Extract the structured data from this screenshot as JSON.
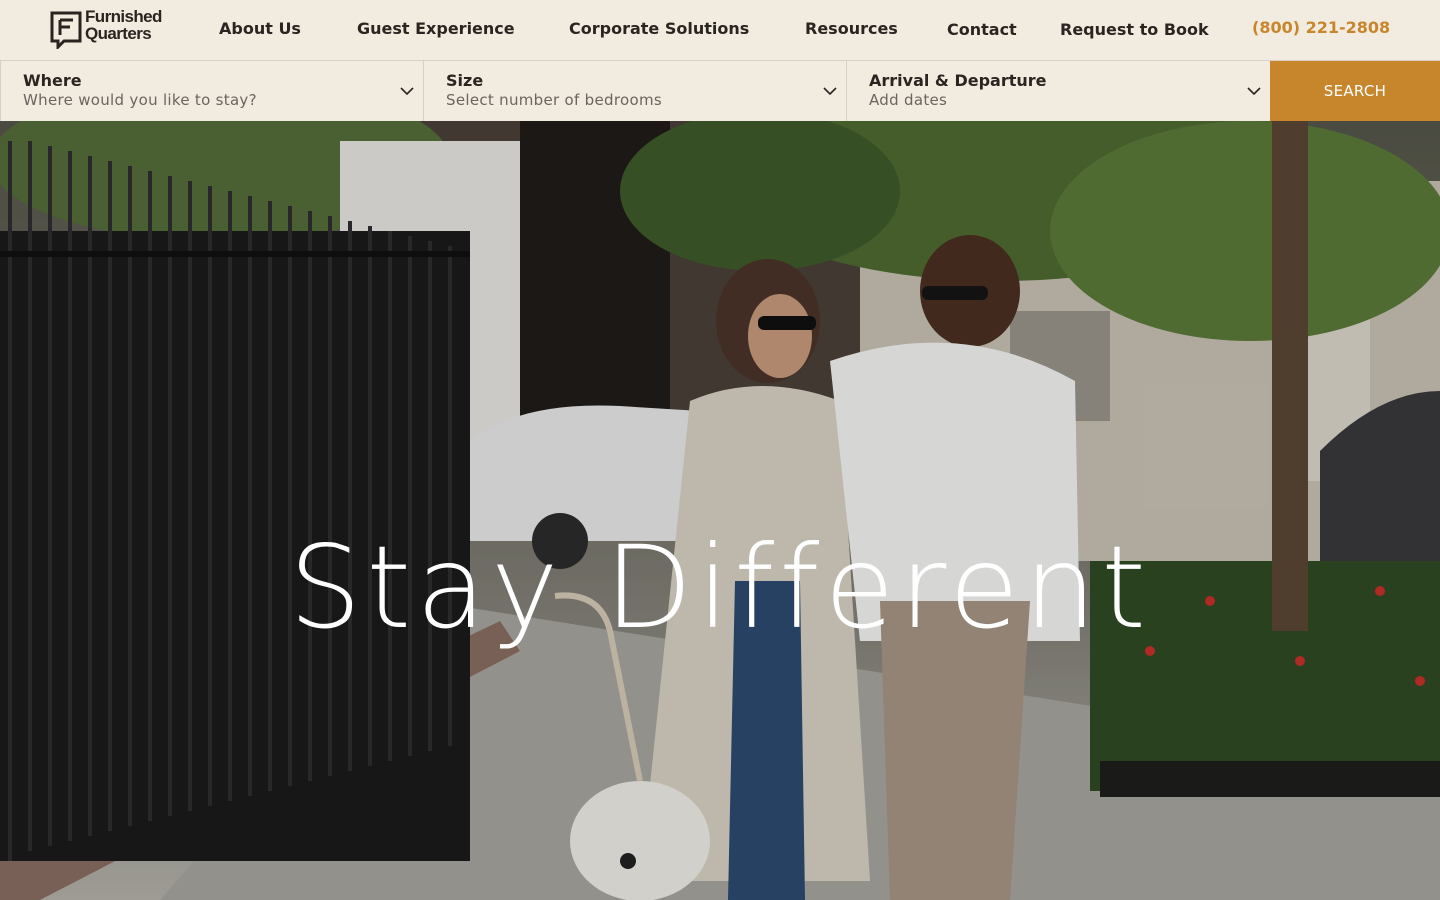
{
  "brand": {
    "name_line1": "Furnished",
    "name_line2": "Quarters",
    "accent_color": "#c8862c",
    "background_color": "#f2ebe0"
  },
  "nav": {
    "items": [
      {
        "label": "About Us"
      },
      {
        "label": "Guest Experience"
      },
      {
        "label": "Corporate Solutions"
      },
      {
        "label": "Resources"
      },
      {
        "label": "Contact"
      },
      {
        "label": "Request to Book"
      }
    ],
    "phone": "(800) 221-2808"
  },
  "search": {
    "where": {
      "label": "Where",
      "placeholder": "Where would you like to stay?",
      "icon": "chevron-down-icon"
    },
    "size": {
      "label": "Size",
      "placeholder": "Select number of bedrooms",
      "icon": "chevron-down-icon"
    },
    "dates": {
      "label": "Arrival & Departure",
      "placeholder": "Add dates",
      "icon": "chevron-down-icon"
    },
    "button_label": "SEARCH"
  },
  "hero": {
    "title": "Stay Different",
    "image_subject": "couple-walking-dog-on-city-sidewalk"
  }
}
